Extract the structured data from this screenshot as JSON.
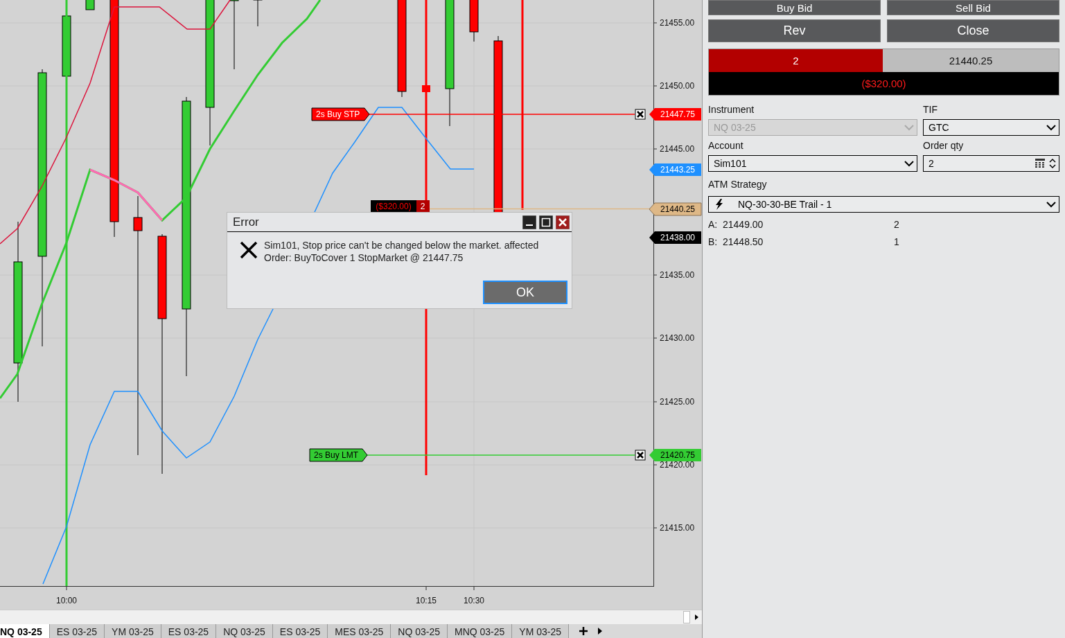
{
  "chart": {
    "price_labels": [
      "21455.00",
      "21450.00",
      "21445.00",
      "21435.00",
      "21430.00",
      "21425.00",
      "21420.00",
      "21415.00"
    ],
    "time_labels": [
      "10:00",
      "10:15",
      "10:30"
    ],
    "orders": [
      {
        "kind": "stop",
        "label": "2s  Buy STP",
        "price": "21447.75"
      },
      {
        "kind": "limit",
        "label": "2s  Buy LMT",
        "price": "21420.75"
      }
    ],
    "position": {
      "pnl": "($320.00)",
      "qty": "2",
      "price": "21440.25"
    },
    "price_markers": [
      {
        "kind": "indicator",
        "price": "21443.25"
      },
      {
        "kind": "last",
        "price": "21438.00"
      }
    ]
  },
  "dialog": {
    "title": "Error",
    "message": "Sim101, Stop price can't be changed below the market. affected Order: BuyToCover 1 StopMarket @ 21447.75",
    "button": "OK"
  },
  "panel": {
    "buttons": [
      "Buy Bid",
      "Sell Bid",
      "Rev",
      "Close"
    ],
    "position": {
      "qty": "2",
      "short": true,
      "price": "21440.25",
      "pnl": "($320.00)"
    },
    "fields": [
      {
        "label": "Instrument",
        "value": "NQ 03-25",
        "kind": "select",
        "disabled": true
      },
      {
        "label": "TIF",
        "value": "GTC",
        "kind": "select",
        "disabled": false
      },
      {
        "label": "Account",
        "value": "Sim101",
        "kind": "select",
        "disabled": false
      },
      {
        "label": "Order qty",
        "value": "2",
        "kind": "number",
        "disabled": false
      }
    ],
    "atm": {
      "label": "ATM Strategy",
      "value": "NQ-30-30-BE Trail - 1"
    },
    "quotes": [
      {
        "label": "A:",
        "price": "21449.00",
        "size": "2"
      },
      {
        "label": "B:",
        "price": "21448.50",
        "size": "1"
      }
    ]
  },
  "tabs": [
    {
      "label": "NQ 03-25",
      "selected": true
    },
    {
      "label": "ES 03-25",
      "selected": false
    },
    {
      "label": "YM 03-25",
      "selected": false
    },
    {
      "label": "ES 03-25",
      "selected": false
    },
    {
      "label": "NQ 03-25",
      "selected": false
    },
    {
      "label": "ES 03-25",
      "selected": false
    },
    {
      "label": "MES 03-25",
      "selected": false
    },
    {
      "label": "NQ 03-25",
      "selected": false
    },
    {
      "label": "MNQ 03-25",
      "selected": false
    },
    {
      "label": "YM 03-25",
      "selected": false
    }
  ]
}
